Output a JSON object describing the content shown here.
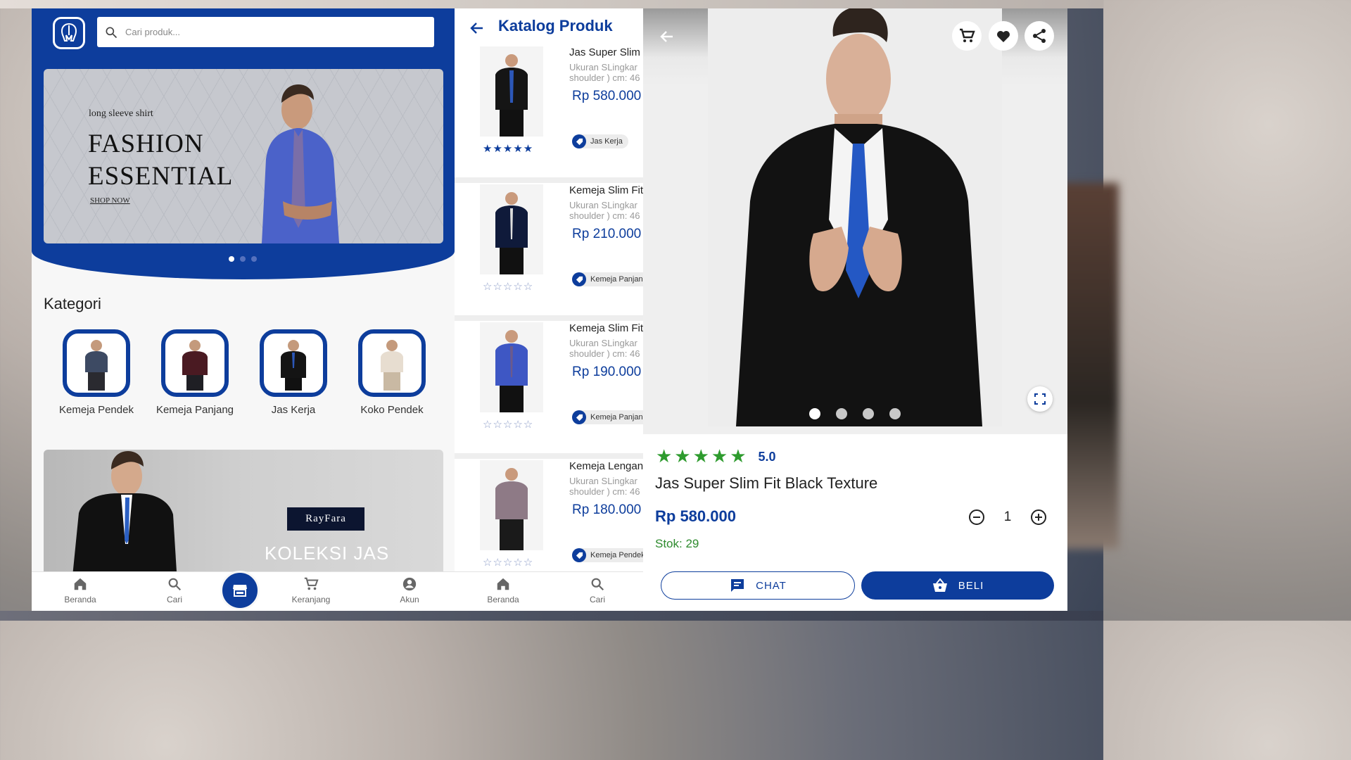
{
  "home": {
    "search": {
      "placeholder": "Cari produk..."
    },
    "banner": {
      "subtitle": "long sleeve shirt",
      "title": "FASHION ESSENTIAL",
      "cta": "SHOP NOW"
    },
    "carousel_dots": 3,
    "section_title": "Kategori",
    "categories": [
      {
        "label": "Kemeja Pendek"
      },
      {
        "label": "Kemeja Panjang"
      },
      {
        "label": "Jas Kerja"
      },
      {
        "label": "Koko Pendek"
      }
    ],
    "promo": {
      "brand": "RayFara",
      "title": "KOLEKSI JAS"
    },
    "nav": [
      {
        "label": "Beranda",
        "icon": "home-icon"
      },
      {
        "label": "Cari",
        "icon": "search-icon"
      },
      {
        "label": "",
        "icon": "store-icon"
      },
      {
        "label": "Keranjang",
        "icon": "cart-icon"
      },
      {
        "label": "Akun",
        "icon": "account-icon"
      }
    ]
  },
  "catalog": {
    "title": "Katalog Produk",
    "products": [
      {
        "name": "Jas Super Slim Fit Black Texture",
        "desc": "Ukuran SLingkar\nshoulder ) cm: 46",
        "price": "Rp 580.000",
        "tag": "Jas Kerja",
        "rating": 5
      },
      {
        "name": "Kemeja Slim Fit",
        "desc": "Ukuran SLingkar\nshoulder ) cm: 46",
        "price": "Rp 210.000",
        "tag": "Kemeja Panjang",
        "rating": 0
      },
      {
        "name": "Kemeja Slim Fit",
        "desc": "Ukuran SLingkar\nshoulder ) cm: 46",
        "price": "Rp 190.000",
        "tag": "Kemeja Panjang",
        "rating": 0
      },
      {
        "name": "Kemeja Lengan",
        "desc": "Ukuran SLingkar\nshoulder ) cm: 46",
        "price": "Rp 180.000",
        "tag": "Kemeja Pendek",
        "rating": 0
      }
    ],
    "nav": [
      {
        "label": "Beranda",
        "icon": "home-icon"
      },
      {
        "label": "Cari",
        "icon": "search-icon"
      }
    ]
  },
  "detail": {
    "rating": "5.0",
    "rating_stars": 5,
    "name": "Jas Super Slim Fit Black Texture",
    "price": "Rp 580.000",
    "stock": "Stok: 29",
    "quantity": "1",
    "image_dots": 4,
    "chat_label": "CHAT",
    "buy_label": "BELI"
  },
  "colors": {
    "primary": "#0d3d9c",
    "success": "#2e9b2e"
  }
}
